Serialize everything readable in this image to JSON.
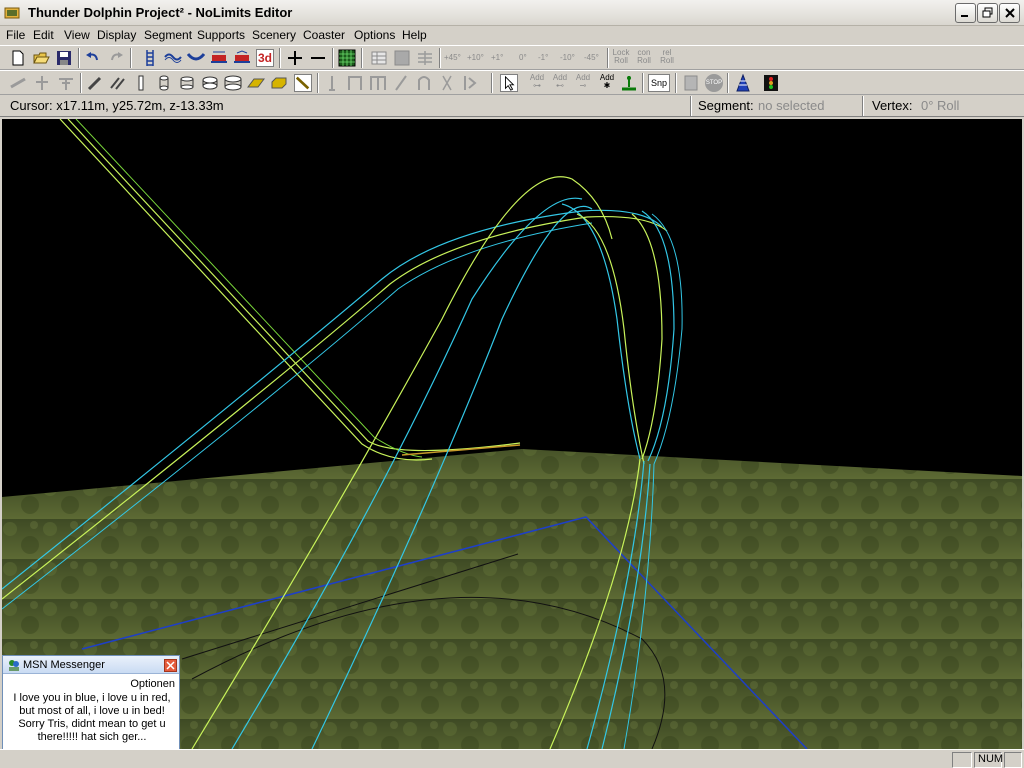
{
  "window": {
    "title": "Thunder Dolphin Project² - NoLimits Editor",
    "controls": [
      "minimize-icon",
      "restore-icon",
      "close-icon"
    ]
  },
  "menu": {
    "items": [
      "File",
      "Edit",
      "View",
      "Display",
      "Segment",
      "Supports",
      "Scenery",
      "Coaster",
      "Options",
      "Help"
    ]
  },
  "toolbar1": {
    "selected_mode_label": "3d",
    "roll_buttons": [
      "+45°",
      "+10°",
      "+1°",
      "0°",
      "-1°",
      "-10°",
      "-45°"
    ],
    "lock_roll": [
      "Lock",
      "Roll"
    ],
    "con_roll": [
      "con",
      "Roll"
    ],
    "rel_roll": [
      "rel",
      "Roll"
    ]
  },
  "toolbar2": {
    "add_labels": [
      "Add",
      "Add",
      "Add",
      "Add"
    ],
    "snap_label": "Snp",
    "stop_label": "STOP"
  },
  "infobar": {
    "cursor": "Cursor: x17.11m, y25.72m, z-13.33m",
    "segment_label": "Segment:",
    "segment_value": "no selected",
    "vertex_label": "Vertex:",
    "vertex_value": "0° Roll"
  },
  "statusbar": {
    "num": "NUM"
  },
  "msn": {
    "title": "MSN Messenger",
    "options": "Optionen",
    "message": "I love you in blue, i love u in red, but most of all, i love u in bed! Sorry Tris, didnt mean to get u there!!!!! hat sich ger...",
    "logo": "msn"
  },
  "colors": {
    "track_green": "#c8f25a",
    "track_cyan": "#33c7e6",
    "ground": "#4d5a2a",
    "sky": "#000000",
    "outline_blue": "#1e3fc8"
  }
}
